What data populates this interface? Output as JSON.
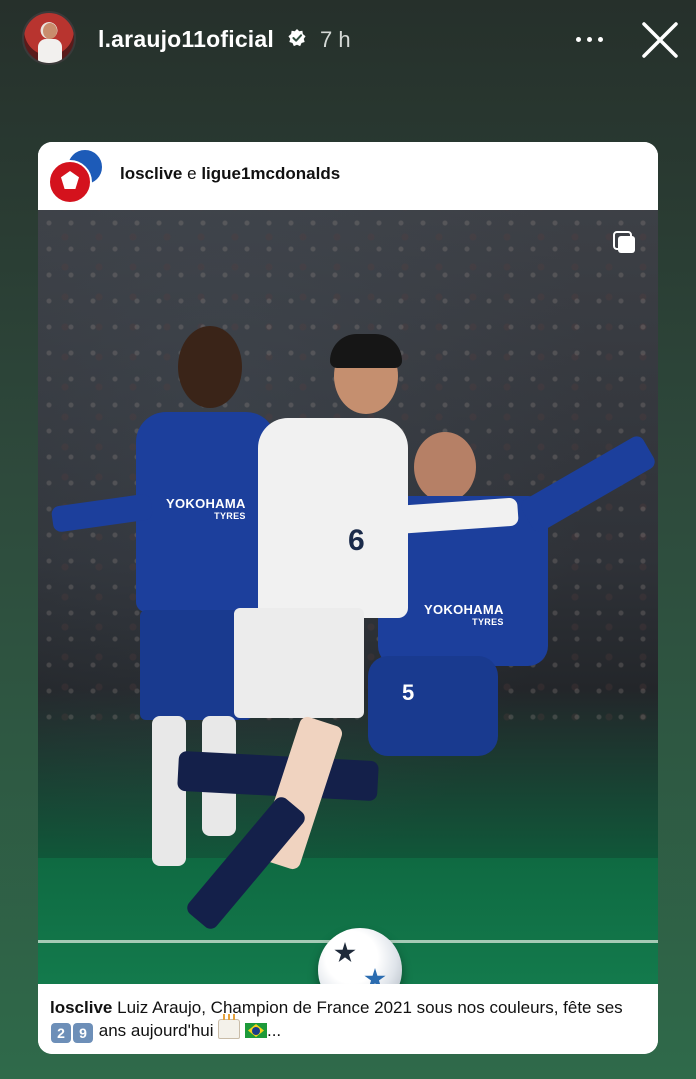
{
  "story": {
    "username": "l.araujo11oficial",
    "time": "7 h"
  },
  "post": {
    "author_primary": "losclive",
    "author_join": "e",
    "author_secondary": "ligue1mcdonalds",
    "image_text": {
      "sponsor_left": "YOKOHAMA",
      "sponsor_left_sub": "TYRES",
      "sponsor_right": "YOKOHAMA",
      "sponsor_right_sub": "TYRES",
      "shirt_number_white": "6",
      "shirt_number_blue": "5"
    },
    "caption_author": "losclive",
    "caption_text_1": "Luiz Araujo, Champion de France 2021 sous nos couleurs, fête ses",
    "caption_digit_1": "2",
    "caption_digit_2": "9",
    "caption_text_2": "ans aujourd'hui",
    "caption_ellipsis": "..."
  },
  "colors": {
    "chelsea_blue": "#1c3f9c",
    "lille_white": "#f1f1f1",
    "lille_red": "#d4121d",
    "background": "#2e4a3c"
  },
  "icons": [
    "verified-icon",
    "more-options-icon",
    "close-icon",
    "multiple-images-icon",
    "cake-emoji-icon",
    "brazil-flag-emoji-icon"
  ]
}
